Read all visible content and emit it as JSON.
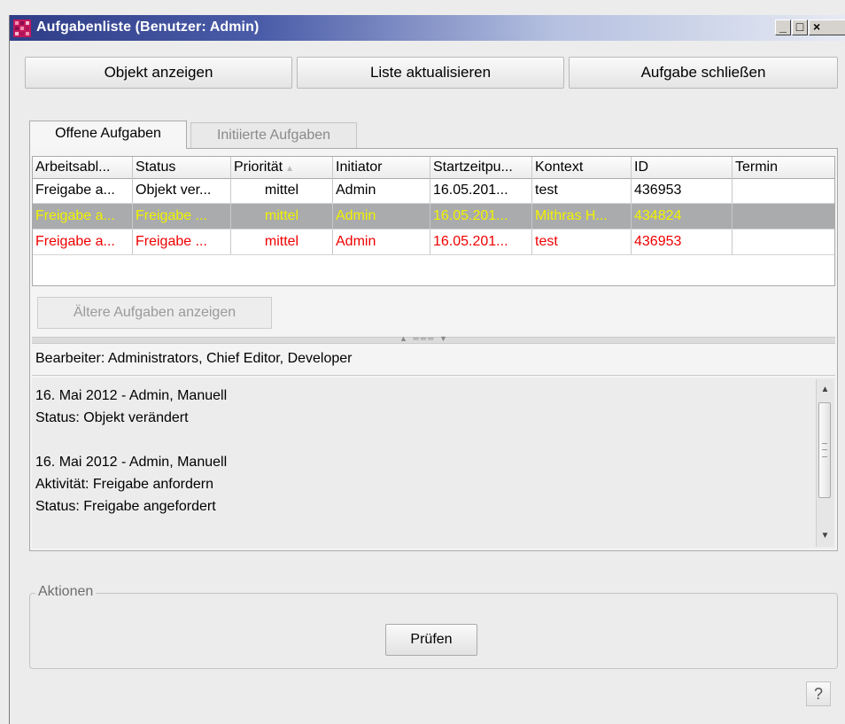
{
  "window": {
    "title": "Aufgabenliste (Benutzer: Admin)"
  },
  "toolbar": {
    "show_object": "Objekt anzeigen",
    "refresh_list": "Liste aktualisieren",
    "close_task": "Aufgabe schließen"
  },
  "tabs": [
    {
      "label": "Offene Aufgaben",
      "active": true
    },
    {
      "label": "Initiierte Aufgaben",
      "active": false
    }
  ],
  "table": {
    "columns": [
      "Arbeitsabl...",
      "Status",
      "Priorität",
      "Initiator",
      "Startzeitpu...",
      "Kontext",
      "ID",
      "Termin"
    ],
    "rows": [
      {
        "workflow": "Freigabe a...",
        "status": "Objekt ver...",
        "priority": "mittel",
        "initiator": "Admin",
        "start": "16.05.201...",
        "context": "test",
        "id": "436953",
        "deadline": "",
        "color": "#000000",
        "selected": false
      },
      {
        "workflow": "Freigabe a...",
        "status": "Freigabe ...",
        "priority": "mittel",
        "initiator": "Admin",
        "start": "16.05.201...",
        "context": "Mithras H...",
        "id": "434824",
        "deadline": "",
        "color": "#f2f200",
        "selected": true
      },
      {
        "workflow": "Freigabe a...",
        "status": "Freigabe ...",
        "priority": "mittel",
        "initiator": "Admin",
        "start": "16.05.201...",
        "context": "test",
        "id": "436953",
        "deadline": "",
        "color": "#ee0000",
        "selected": false
      }
    ]
  },
  "older_tasks_button": "Ältere Aufgaben anzeigen",
  "editors_label": "Bearbeiter: Administrators, Chief Editor, Developer",
  "history": [
    "16. Mai 2012 - Admin, Manuell",
    "Status: Objekt verändert",
    "",
    "16. Mai 2012 - Admin, Manuell",
    "Aktivität: Freigabe anfordern",
    "Status: Freigabe angefordert"
  ],
  "actions": {
    "legend": "Aktionen",
    "check_button": "Prüfen"
  },
  "help_label": "?"
}
